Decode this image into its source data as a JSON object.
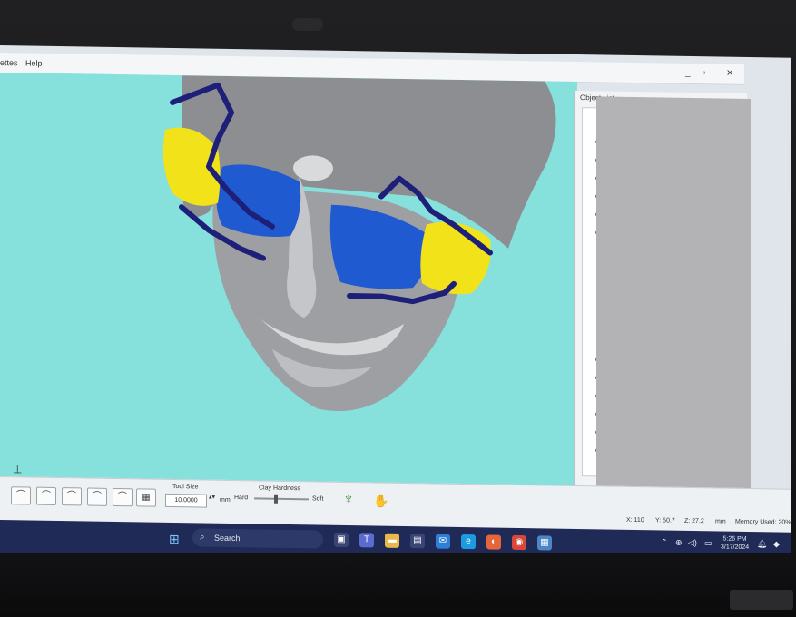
{
  "menubar": {
    "items": [
      "ettes",
      "Help"
    ],
    "minimize": "_",
    "restore": "▫",
    "close": "✕"
  },
  "object_list": {
    "title": "Object List"
  },
  "toolbar": {
    "tool_icons": [
      "sculpt-tool-icon",
      "carve-tool-icon",
      "smooth-tool-icon",
      "emboss-tool-icon",
      "tug-tool-icon",
      "layer-tool-icon"
    ],
    "tool_size_label": "Tool Size",
    "tool_size_value": "10.0000",
    "tool_size_unit": "mm",
    "clay_hardness_label": "Clay Hardness",
    "hard_label": "Hard",
    "soft_label": "Soft"
  },
  "status": {
    "x": "X: 110",
    "y": "Y: 50.7",
    "z": "Z: 27.2",
    "unit": "mm",
    "memory": "Memory Used: 20%"
  },
  "taskbar": {
    "search_label": "Search",
    "time": "5:26 PM",
    "date": "3/17/2024"
  },
  "colors": {
    "viewport_bg": "#86e1dd",
    "skull": "#9a9b9e",
    "implant_blue": "#1f5ad0",
    "implant_yellow": "#f1e21a",
    "plate": "#1d1f78",
    "taskbar": "#1f2a56"
  }
}
